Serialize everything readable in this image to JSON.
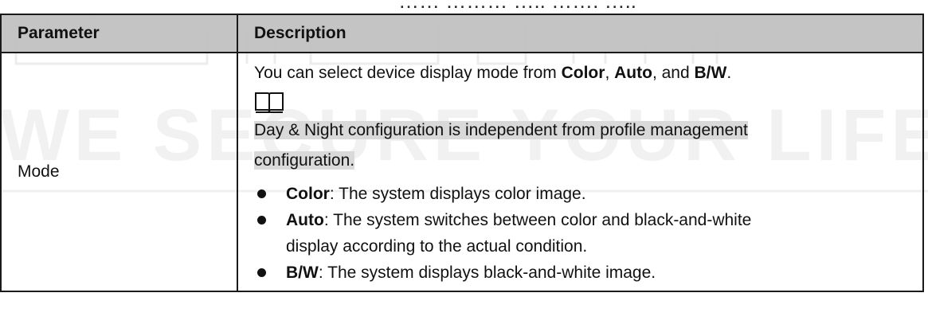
{
  "top_cropped_text": "…… ……… ….. ……. …..",
  "watermark_text": "WE SECURE YOUR LIFE",
  "table": {
    "headers": [
      "Parameter",
      "Description"
    ],
    "row": {
      "parameter": "Mode",
      "intro_prefix": "You can select device display mode from ",
      "opt_color": "Color",
      "sep1": ", ",
      "opt_auto": "Auto",
      "sep2": ", and ",
      "opt_bw": "B/W",
      "intro_suffix": ".",
      "note_icon": "book-note-icon",
      "note_line1": "Day & Night configuration is independent from profile management",
      "note_line2": "configuration.",
      "items": [
        {
          "term": "Color",
          "text_lines": [
            ": The system displays color image."
          ]
        },
        {
          "term": "Auto",
          "text_lines": [
            ": The system switches between color and black-and-white",
            "display according to the actual condition."
          ]
        },
        {
          "term": "B/W",
          "text_lines": [
            ": The system displays black-and-white image."
          ]
        }
      ]
    }
  }
}
